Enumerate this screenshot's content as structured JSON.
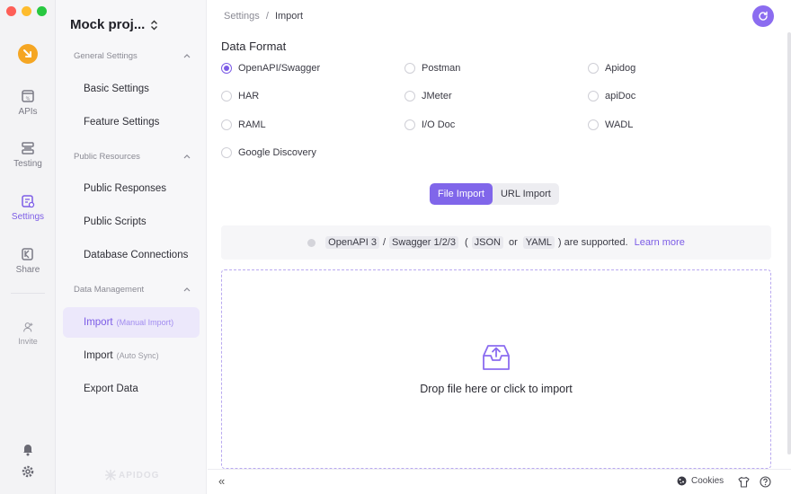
{
  "rail": {
    "items": [
      {
        "label": "APIs",
        "icon": "api-doc-icon"
      },
      {
        "label": "Testing",
        "icon": "testing-icon"
      },
      {
        "label": "Settings",
        "icon": "settings-doc-icon"
      },
      {
        "label": "Share",
        "icon": "share-icon"
      }
    ],
    "invite": "Invite",
    "accent": "#7c5ce6"
  },
  "sidebar": {
    "project": "Mock proj...",
    "groups": [
      {
        "title": "General Settings"
      },
      {
        "title": "Public Resources"
      },
      {
        "title": "Data Management"
      }
    ],
    "items": [
      {
        "label": "Basic Settings"
      },
      {
        "label": "Feature Settings"
      },
      {
        "label": "Public Responses"
      },
      {
        "label": "Public Scripts"
      },
      {
        "label": "Database Connections"
      },
      {
        "label": "Import",
        "sub": "(Manual Import)"
      },
      {
        "label": "Import",
        "sub": "(Auto Sync)"
      },
      {
        "label": "Export Data"
      }
    ],
    "watermark": "APIDOG"
  },
  "main": {
    "breadcrumb": {
      "root": "Settings",
      "sep": "/",
      "current": "Import"
    },
    "section_title": "Data Format",
    "formats": [
      {
        "label": "OpenAPI/Swagger",
        "checked": true
      },
      {
        "label": "Postman"
      },
      {
        "label": "Apidog"
      },
      {
        "label": "HAR"
      },
      {
        "label": "JMeter"
      },
      {
        "label": "apiDoc"
      },
      {
        "label": "RAML"
      },
      {
        "label": "I/O Doc"
      },
      {
        "label": "WADL"
      },
      {
        "label": "Google Discovery"
      }
    ],
    "tabs": {
      "file": "File Import",
      "url": "URL Import"
    },
    "info": {
      "openapi": "OpenAPI 3",
      "slash": "/",
      "swagger": "Swagger 1/2/3",
      "paren_open": "(",
      "json": "JSON",
      "or": "or",
      "yaml": "YAML",
      "tail": ") are supported.",
      "learn_more": "Learn more"
    },
    "drop_text": "Drop file here or click to import"
  },
  "footer": {
    "collapse": "«",
    "cookies": "Cookies"
  }
}
